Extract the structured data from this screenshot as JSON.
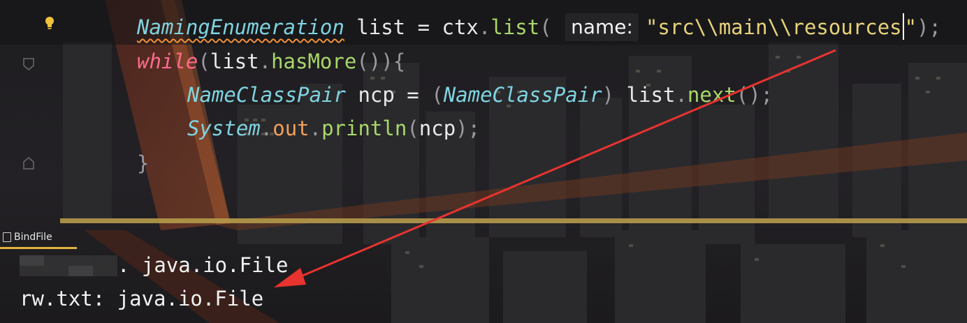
{
  "editor": {
    "lines": [
      {
        "tokens": [
          {
            "t": "NamingEnumeration",
            "c": "type squiggle"
          },
          {
            "t": " list ",
            "c": "ident"
          },
          {
            "t": "=",
            "c": "op"
          },
          {
            "t": " ctx",
            "c": "ident"
          },
          {
            "t": ".",
            "c": "punct"
          },
          {
            "t": "list",
            "c": "method"
          },
          {
            "t": "( ",
            "c": "punct"
          },
          {
            "hint": "name:"
          },
          {
            "t": "\"src\\\\main\\\\resources",
            "c": "str"
          },
          {
            "caret": true
          },
          {
            "t": "\"",
            "c": "str"
          },
          {
            "t": ");",
            "c": "punct"
          }
        ]
      },
      {
        "tokens": [
          {
            "t": "while",
            "c": "kw"
          },
          {
            "t": "(",
            "c": "punct"
          },
          {
            "t": "list",
            "c": "ident"
          },
          {
            "t": ".",
            "c": "punct"
          },
          {
            "t": "hasMore",
            "c": "method"
          },
          {
            "t": "()){",
            "c": "punct"
          }
        ]
      },
      {
        "tokens": [
          {
            "t": "NameClassPair",
            "c": "type"
          },
          {
            "t": " ncp ",
            "c": "ident"
          },
          {
            "t": "=",
            "c": "op"
          },
          {
            "t": " (",
            "c": "punct"
          },
          {
            "t": "NameClassPair",
            "c": "type"
          },
          {
            "t": ") ",
            "c": "punct"
          },
          {
            "t": "list",
            "c": "ident"
          },
          {
            "t": ".",
            "c": "punct"
          },
          {
            "t": "next",
            "c": "method"
          },
          {
            "t": "();",
            "c": "punct"
          }
        ]
      },
      {
        "tokens": [
          {
            "t": "System",
            "c": "type"
          },
          {
            "t": ".",
            "c": "punct"
          },
          {
            "t": "out",
            "c": "field"
          },
          {
            "t": ".",
            "c": "punct"
          },
          {
            "t": "println",
            "c": "method"
          },
          {
            "t": "(",
            "c": "punct"
          },
          {
            "t": "ncp",
            "c": "ident"
          },
          {
            "t": ");",
            "c": "punct"
          }
        ]
      },
      {
        "tokens": [
          {
            "t": "}",
            "c": "punct"
          }
        ]
      }
    ]
  },
  "run_panel": {
    "tab_label": "BindFile"
  },
  "console": {
    "line1_suffix": ". java.io.File",
    "line2": "rw.txt: java.io.File"
  },
  "colors": {
    "accent_underline": "#e1b23e",
    "arrow": "#e8332f",
    "divider": "#b59a4a"
  },
  "icons": {
    "gutter": "lightbulb-icon",
    "tab": "run-window-icon"
  }
}
